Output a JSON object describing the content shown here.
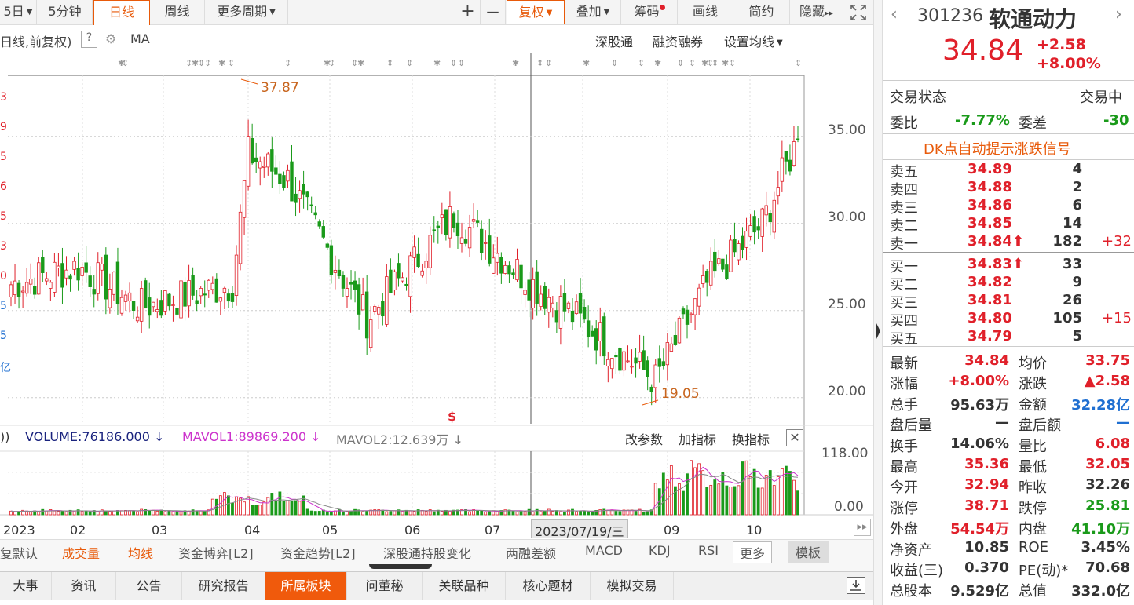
{
  "toolbar": {
    "period_partial": "5日",
    "min5": "5分钟",
    "daily": "日线",
    "weekly": "周线",
    "more_period": "更多周期",
    "plus": "+",
    "minus": "—",
    "fuquan": "复权",
    "overlay": "叠加",
    "chips": "筹码",
    "draw": "画线",
    "simple": "简约",
    "hide": "隐藏"
  },
  "chart": {
    "subtitle": "日线,前复权)",
    "help": "?",
    "ma": "MA",
    "links": [
      "深股通",
      "融资融券",
      "设置均线"
    ],
    "high_label": "37.87",
    "low_label": "19.05",
    "price_ticks": [
      "35.00",
      "30.00",
      "25.00",
      "20.00"
    ],
    "left_edge_digits": [
      "3",
      "9",
      "5",
      "6",
      "5",
      "3",
      "0",
      "5",
      "5",
      "亿"
    ],
    "vol_legend": {
      "prefix": "))",
      "volume": "VOLUME:76186.000",
      "mavol1": "MAVOL1:89869.200",
      "mavol2": "MAVOL2:12.639万"
    },
    "vol_actions": [
      "改参数",
      "加指标",
      "换指标"
    ],
    "vol_ticks": [
      "118.00",
      "0.00"
    ],
    "x_labels": [
      "2023",
      "02",
      "03",
      "04",
      "05",
      "06",
      "07",
      "09",
      "10"
    ],
    "cursor_date": "2023/07/19/三",
    "colors": {
      "up": "#e0202a",
      "down": "#1a9a1a",
      "mavol1": "#cc33cc",
      "mavol2": "#888888",
      "accent": "#e85a0a"
    }
  },
  "chart_data": {
    "type": "candlestick",
    "title": "",
    "period": "daily",
    "x_range": [
      "2023-01",
      "2023-10"
    ],
    "ylim": [
      18.5,
      38.5
    ],
    "y_ticks": [
      35.0,
      30.0,
      25.0,
      20.0
    ],
    "high": {
      "value": 37.87,
      "month": "04"
    },
    "low": {
      "value": 19.05,
      "month": "08"
    },
    "last_close": 34.84,
    "trend_close": [
      {
        "t": "2023-01",
        "v": 26.5
      },
      {
        "t": "2023-02",
        "v": 27.5
      },
      {
        "t": "2023-03",
        "v": 25.2
      },
      {
        "t": "2023-03-end",
        "v": 26.5
      },
      {
        "t": "2023-04-start",
        "v": 34.0
      },
      {
        "t": "2023-04-mid",
        "v": 32.5
      },
      {
        "t": "2023-05",
        "v": 24.5
      },
      {
        "t": "2023-06",
        "v": 30.5
      },
      {
        "t": "2023-07",
        "v": 26.5
      },
      {
        "t": "2023-08",
        "v": 21.0
      },
      {
        "t": "2023-09",
        "v": 26.5
      },
      {
        "t": "2023-10",
        "v": 30.0
      },
      {
        "t": "2023-10-end",
        "v": 34.84
      }
    ],
    "volume_ylim": [
      0,
      118
    ],
    "volume_legend": [
      "VOLUME",
      "MAVOL1",
      "MAVOL2"
    ]
  },
  "bottom_tabs1": [
    "复默认",
    "成交量",
    "均线",
    "资金博弈[L2]",
    "资金趋势[L2]",
    "深股通持股变化",
    "两融差额",
    "MACD",
    "KDJ",
    "RSI",
    "更多",
    "模板"
  ],
  "bottom_tabs2": [
    "大事",
    "资讯",
    "公告",
    "研究报告",
    "所属板块",
    "问董秘",
    "关联品种",
    "核心题材",
    "模拟交易"
  ],
  "stock": {
    "code": "301236",
    "name": "软通动力",
    "price": "34.84",
    "change": "+2.58",
    "change_pct": "+8.00%",
    "status_label": "交易状态",
    "status_value": "交易中",
    "weibi_label": "委比",
    "weibi": "-7.77%",
    "weicha_label": "委差",
    "weicha": "-30",
    "dk_link": "DK点自动提示涨跌信号"
  },
  "order_book": {
    "asks": [
      {
        "label": "卖五",
        "price": "34.89",
        "vol": "4",
        "delta": ""
      },
      {
        "label": "卖四",
        "price": "34.88",
        "vol": "2",
        "delta": ""
      },
      {
        "label": "卖三",
        "price": "34.86",
        "vol": "6",
        "delta": ""
      },
      {
        "label": "卖二",
        "price": "34.85",
        "vol": "14",
        "delta": ""
      },
      {
        "label": "卖一",
        "price": "34.84",
        "vol": "182",
        "delta": "+32"
      }
    ],
    "bids": [
      {
        "label": "买一",
        "price": "34.83",
        "vol": "33",
        "delta": ""
      },
      {
        "label": "买二",
        "price": "34.82",
        "vol": "9",
        "delta": ""
      },
      {
        "label": "买三",
        "price": "34.81",
        "vol": "26",
        "delta": ""
      },
      {
        "label": "买四",
        "price": "34.80",
        "vol": "105",
        "delta": "+15"
      },
      {
        "label": "买五",
        "price": "34.79",
        "vol": "5",
        "delta": ""
      }
    ]
  },
  "stats": [
    {
      "l1": "最新",
      "v1": "34.84",
      "c1": "red",
      "l2": "均价",
      "v2": "33.75",
      "c2": "red"
    },
    {
      "l1": "涨幅",
      "v1": "+8.00%",
      "c1": "red",
      "l2": "涨跌",
      "v2": "▲2.58",
      "c2": "red"
    },
    {
      "l1": "总手",
      "v1": "95.63万",
      "c1": "",
      "l2": "金额",
      "v2": "32.28亿",
      "c2": "blue"
    },
    {
      "l1": "盘后量",
      "v1": "—",
      "c1": "",
      "l2": "盘后额",
      "v2": "—",
      "c2": "blue"
    },
    {
      "l1": "换手",
      "v1": "14.06%",
      "c1": "",
      "l2": "量比",
      "v2": "6.08",
      "c2": "red"
    },
    {
      "l1": "最高",
      "v1": "35.36",
      "c1": "red",
      "l2": "最低",
      "v2": "32.05",
      "c2": "red"
    },
    {
      "l1": "今开",
      "v1": "32.94",
      "c1": "red",
      "l2": "昨收",
      "v2": "32.26",
      "c2": ""
    },
    {
      "l1": "涨停",
      "v1": "38.71",
      "c1": "red",
      "l2": "跌停",
      "v2": "25.81",
      "c2": "green"
    },
    {
      "l1": "外盘",
      "v1": "54.54万",
      "c1": "red",
      "l2": "内盘",
      "v2": "41.10万",
      "c2": "green"
    },
    {
      "l1": "净资产",
      "v1": "10.85",
      "c1": "",
      "l2": "ROE",
      "v2": "3.45%",
      "c2": ""
    },
    {
      "l1": "收益(三)",
      "v1": "0.370",
      "c1": "",
      "l2": "PE(动)*",
      "v2": "70.68",
      "c2": ""
    },
    {
      "l1": "总股本",
      "v1": "9.529亿",
      "c1": "",
      "l2": "总值",
      "v2": "332.0亿",
      "c2": ""
    }
  ]
}
